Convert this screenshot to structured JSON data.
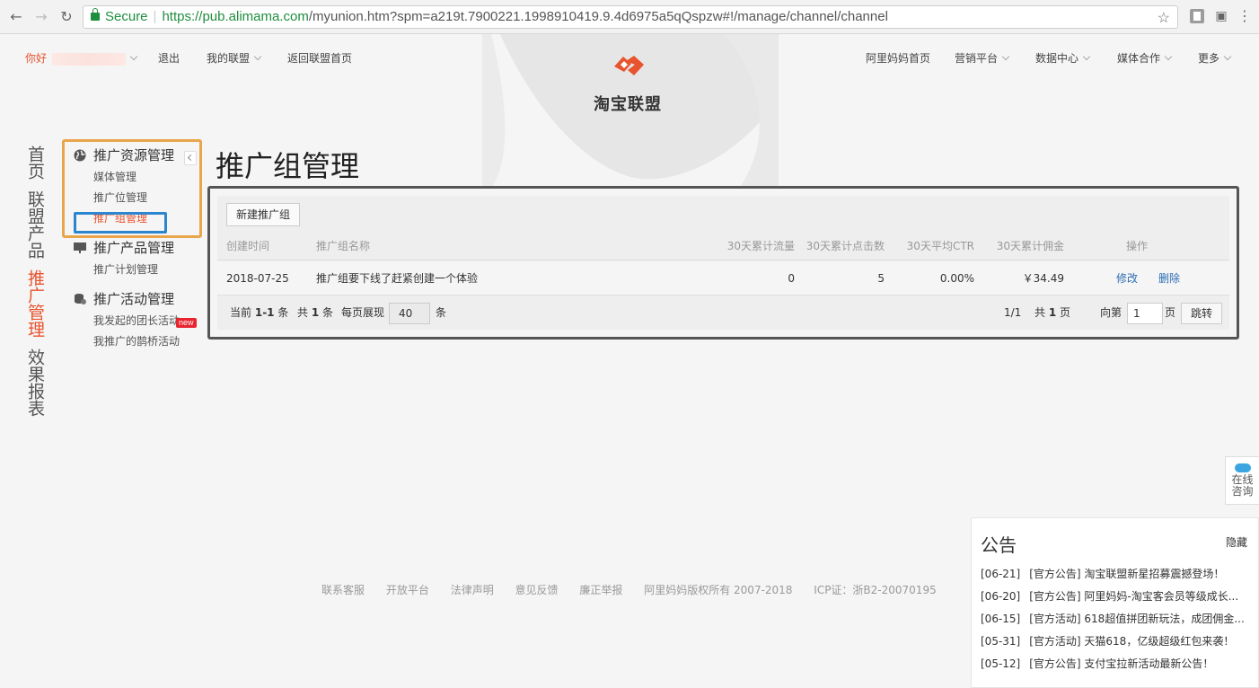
{
  "browser": {
    "secure_label": "Secure",
    "url_host": "https://pub.alimama.com",
    "url_rest": "/myunion.htm?spm=a219t.7900221.1998910419.9.4d6975a5qQspzw#!/manage/channel/channel"
  },
  "topnav": {
    "greeting": "你好",
    "logout": "退出",
    "my_union": "我的联盟",
    "back_home": "返回联盟首页",
    "right": [
      "阿里妈妈首页",
      "营销平台",
      "数据中心",
      "媒体合作",
      "更多"
    ],
    "logo_text": "淘宝联盟"
  },
  "vnav": [
    "首页",
    "联盟产品",
    "推广管理",
    "效果报表"
  ],
  "sidebar": {
    "groups": [
      {
        "title": "推广资源管理",
        "items": [
          "媒体管理",
          "推广位管理",
          "推广组管理"
        ]
      },
      {
        "title": "推广产品管理",
        "items": [
          "推广计划管理"
        ]
      },
      {
        "title": "推广活动管理",
        "items": [
          "我发起的团长活动",
          "我推广的鹊桥活动"
        ]
      }
    ],
    "new_badge": "new"
  },
  "main": {
    "title": "推广组管理",
    "new_button": "新建推广组",
    "columns": [
      "创建时间",
      "推广组名称",
      "30天累计流量",
      "30天累计点击数",
      "30天平均CTR",
      "30天累计佣金",
      "操作"
    ],
    "rows": [
      {
        "created": "2018-07-25",
        "name": "推广组要下线了赶紧创建一个体验",
        "traffic": "0",
        "clicks": "5",
        "ctr": "0.00%",
        "commission": "￥34.49",
        "edit": "修改",
        "delete": "删除"
      }
    ],
    "pager": {
      "current_prefix": "当前",
      "current_range": "1-1",
      "unit": "条",
      "total_prefix": "共",
      "total": "1",
      "per_page_label": "每页展现",
      "per_page": "40",
      "page_info": "1/1",
      "total_pages_prefix": "共",
      "total_pages": "1",
      "page_unit": "页",
      "goto_prefix": "向第",
      "goto_value": "1",
      "goto_button": "跳转"
    }
  },
  "footer": [
    "联系客服",
    "开放平台",
    "法律声明",
    "意见反馈",
    "廉正举报",
    "阿里妈妈版权所有 2007-2018",
    "ICP证：浙B2-20070195"
  ],
  "consult": {
    "line1": "在线",
    "line2": "咨询"
  },
  "notice": {
    "title": "公告",
    "hide": "隐藏",
    "items": [
      {
        "date": "[06-21]",
        "text": "[官方公告] 淘宝联盟新星招募震撼登场！"
      },
      {
        "date": "[06-20]",
        "text": "[官方公告] 阿里妈妈-淘宝客会员等级成长..."
      },
      {
        "date": "[06-15]",
        "text": "[官方活动] 618超值拼团新玩法，成团佣金..."
      },
      {
        "date": "[05-31]",
        "text": "[官方活动] 天猫618，亿级超级红包来袭！"
      },
      {
        "date": "[05-12]",
        "text": "[官方公告] 支付宝拉新活动最新公告！"
      }
    ]
  },
  "colors": {
    "accent": "#e8542e",
    "link": "#2b6db3",
    "highlight_orange": "#e9a54a",
    "highlight_blue": "#2b86cf"
  }
}
